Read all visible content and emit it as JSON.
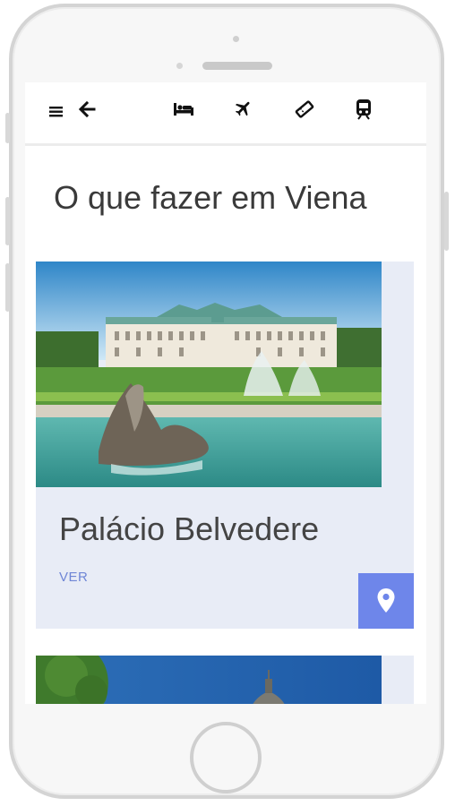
{
  "toolbar": {
    "icons": [
      "menu-icon",
      "back-arrow-icon",
      "bed-icon",
      "airplane-icon",
      "ticket-icon",
      "train-icon"
    ]
  },
  "page": {
    "title": "O que fazer em Viena"
  },
  "cards": [
    {
      "title": "Palácio Belvedere",
      "link_label": "VER",
      "image": "belvedere-palace-photo",
      "action_icon": "map-pin-icon"
    },
    {
      "image": "vienna-dome-photo"
    }
  ],
  "colors": {
    "accent": "#6e86ea",
    "link": "#6f86d6",
    "card_bg": "#e8ecf6",
    "title_text": "#3a3a3a"
  }
}
